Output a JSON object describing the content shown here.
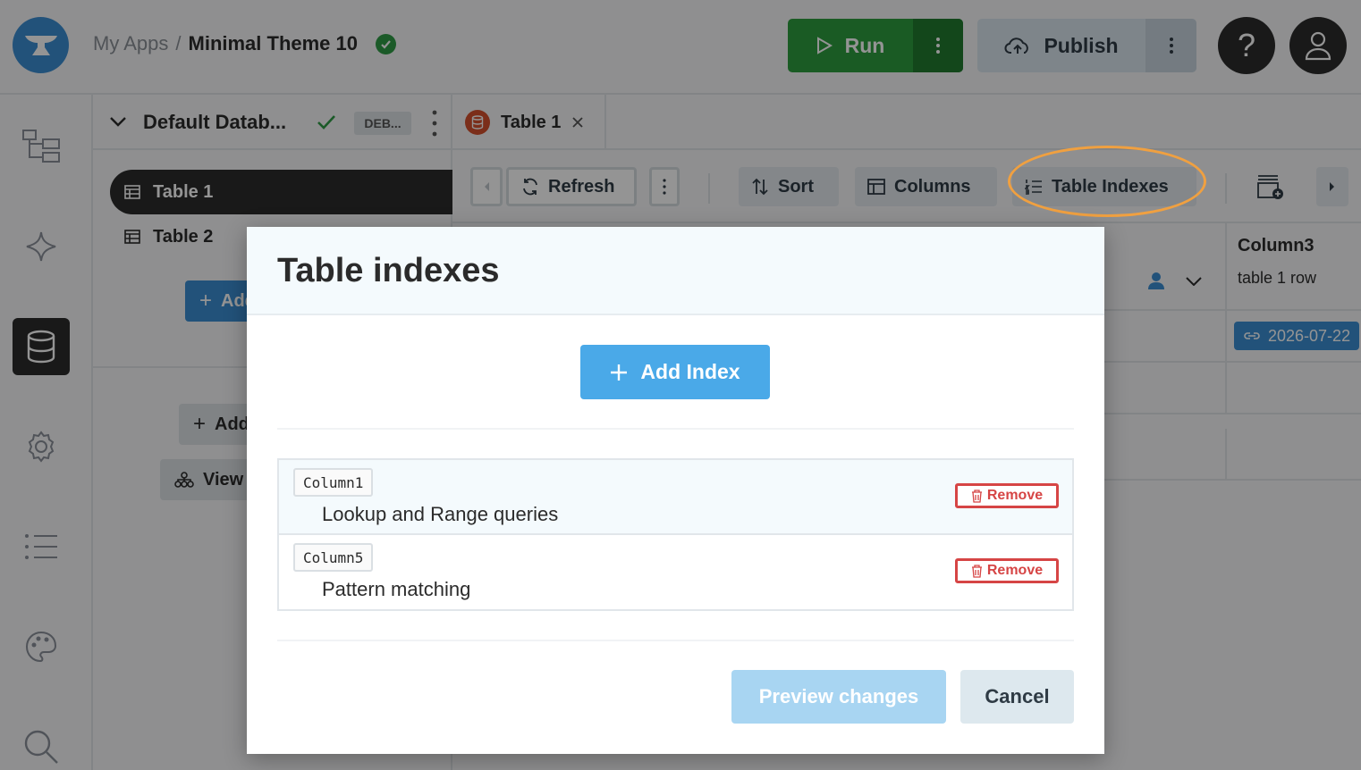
{
  "topbar": {
    "breadcrumb_root": "My Apps",
    "breadcrumb_sep": "/",
    "app_name": "Minimal Theme 10",
    "run_label": "Run",
    "publish_label": "Publish",
    "help_label": "?"
  },
  "db_panel": {
    "database_name": "Default Datab...",
    "env_tag": "DEB...",
    "tables": [
      {
        "label": "Table 1"
      },
      {
        "label": "Table 2"
      }
    ],
    "add_table_label": "Add",
    "add_label": "Add",
    "view_label": "View"
  },
  "main": {
    "tab_label": "Table 1",
    "toolbar": {
      "refresh_label": "Refresh",
      "sort_label": "Sort",
      "columns_label": "Columns",
      "indexes_label": "Table Indexes"
    },
    "column3": {
      "title": "Column3",
      "subtitle": "table 1 row"
    },
    "date_value": "2026-07-22"
  },
  "modal": {
    "title": "Table indexes",
    "add_index_label": "Add Index",
    "indexes": [
      {
        "column": "Column1",
        "type": "Lookup and Range queries",
        "remove_label": "Remove"
      },
      {
        "column": "Column5",
        "type": "Pattern matching",
        "remove_label": "Remove"
      }
    ],
    "preview_label": "Preview changes",
    "cancel_label": "Cancel"
  },
  "colors": {
    "accent_blue": "#4aa9e8",
    "run_green": "#2e9e3f",
    "remove_red": "#d64545",
    "highlight_orange": "#f0a040"
  }
}
